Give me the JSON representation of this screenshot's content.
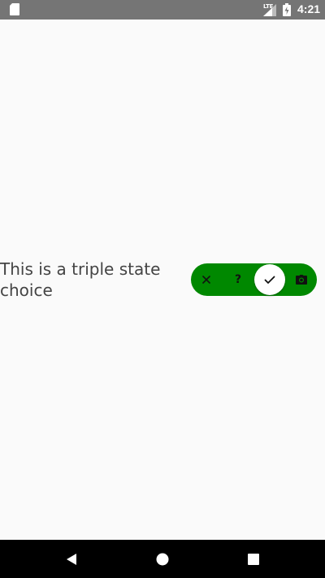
{
  "status_bar": {
    "network": "LTE",
    "time": "4:21",
    "icons": [
      "sd-card-icon",
      "signal-icon",
      "battery-icon"
    ]
  },
  "content": {
    "label": "This is a triple state choice"
  },
  "triple_switch": {
    "options": [
      "close-icon",
      "question-mark-icon",
      "check-icon",
      "camera-icon"
    ],
    "question_glyph": "?",
    "selected_index": 2,
    "track_color": "#008800",
    "knob_color": "#ffffff"
  },
  "nav_bar": {
    "buttons": [
      "back-icon",
      "home-icon",
      "recent-apps-icon"
    ]
  }
}
